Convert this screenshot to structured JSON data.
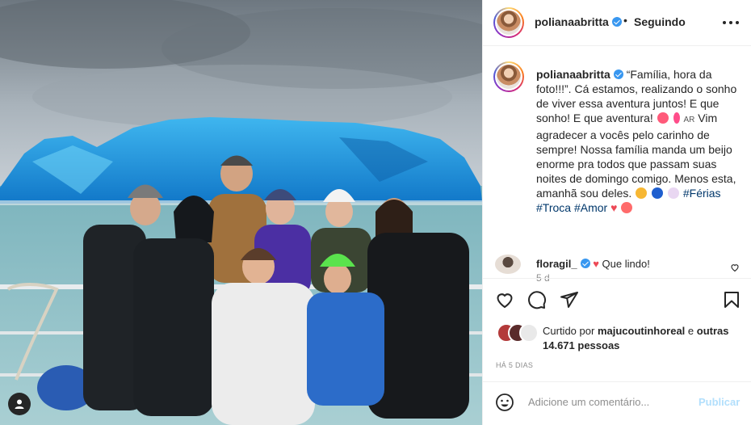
{
  "post": {
    "username": "polianaabritta",
    "follow_status": "Seguindo",
    "separator": "•",
    "more_label": "•••"
  },
  "caption": {
    "part1": "“Família, hora da foto!!!”. Cá estamos, realizando o sonho de viver essa aventura juntos! E que sonho! E que aventura!",
    "flag_text": "AR",
    "part2": "Vim agradecer a vocês pelo carinho de sempre! Nossa família manda um beijo enorme pra todos que passam suas noites de domingo comigo. Menos esta, amanhã sou deles.",
    "hashtags": [
      "#Férias",
      "#Troca",
      "#Amor"
    ],
    "time_ago": "5 d"
  },
  "comment": {
    "username": "floragil_",
    "text": "Que lindo!"
  },
  "likes": {
    "prefix": "Curtido por",
    "by_user": "majucoutinhoreal",
    "and": "e",
    "others": "outras 14.671 pessoas"
  },
  "post_date": "HÁ 5 DIAS",
  "add_comment": {
    "placeholder": "Adicione um comentário...",
    "publish_label": "Publicar"
  },
  "icons": [
    "more-icon",
    "verified-icon",
    "heart-icon",
    "comment-icon",
    "share-icon",
    "bookmark-icon",
    "emoji-icon",
    "user-tag-icon"
  ],
  "colors": {
    "verified": "#3897f0",
    "hashtag": "#00376b",
    "like_red": "#ed4956",
    "publish_disabled": "#b2dffc",
    "muted": "#8e8e8e"
  }
}
